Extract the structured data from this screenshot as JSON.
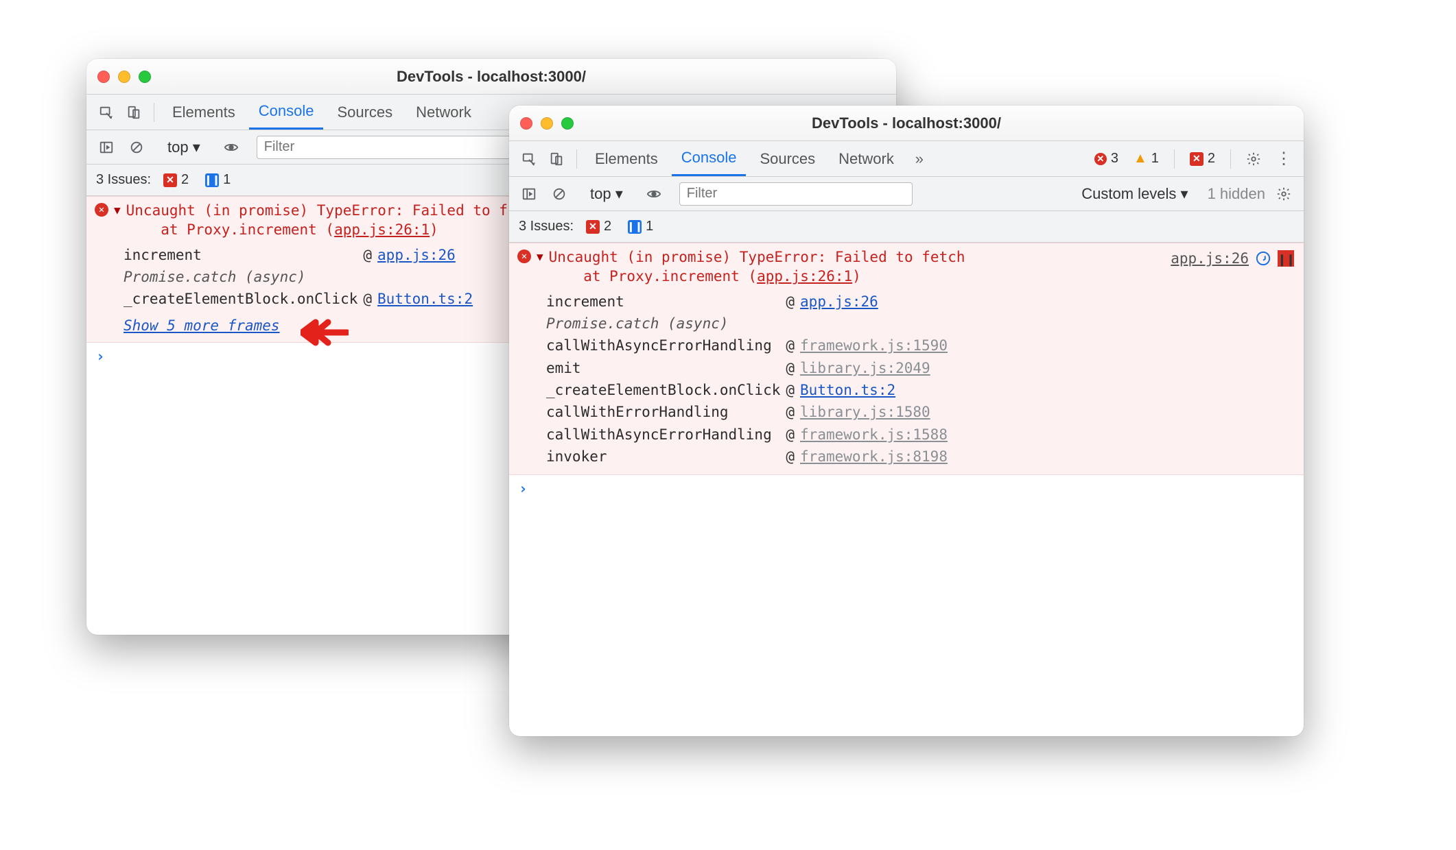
{
  "window1": {
    "title": "DevTools - localhost:3000/",
    "tabs": [
      "Elements",
      "Console",
      "Sources",
      "Network"
    ],
    "activeTab": "Console",
    "filterPlaceholder": "Filter",
    "context": "top",
    "issuesLabel": "3 Issues:",
    "issueErr": "2",
    "issueMsg": "1",
    "error": {
      "head1": "Uncaught (in promise) TypeError: Failed to f",
      "head2": "at Proxy.increment (",
      "headLoc": "app.js:26:1",
      "head2end": ")",
      "rows": [
        {
          "fn": "increment",
          "at": "@",
          "loc": "app.js:26",
          "muted": false
        },
        {
          "divider": "Promise.catch (async)"
        },
        {
          "fn": "_createElementBlock.onClick",
          "at": "@",
          "loc": "Button.ts:2",
          "muted": false
        }
      ],
      "showMore": "Show 5 more frames"
    }
  },
  "window2": {
    "title": "DevTools - localhost:3000/",
    "tabs": [
      "Elements",
      "Console",
      "Sources",
      "Network"
    ],
    "activeTab": "Console",
    "filterPlaceholder": "Filter",
    "context": "top",
    "levels": "Custom levels",
    "hidden": "1 hidden",
    "badges": {
      "err": "3",
      "warn": "1",
      "msg": "2"
    },
    "issuesLabel": "3 Issues:",
    "issueErr": "2",
    "issueMsg": "1",
    "error": {
      "head1": "Uncaught (in promise) TypeError: Failed to fetch",
      "head2": "at Proxy.increment (",
      "headLoc": "app.js:26:1",
      "head2end": ")",
      "srcRight": "app.js:26",
      "rows": [
        {
          "fn": "increment",
          "at": "@",
          "loc": "app.js:26",
          "muted": false
        },
        {
          "divider": "Promise.catch (async)"
        },
        {
          "fn": "callWithAsyncErrorHandling",
          "at": "@",
          "loc": "framework.js:1590",
          "muted": true
        },
        {
          "fn": "emit",
          "at": "@",
          "loc": "library.js:2049",
          "muted": true
        },
        {
          "fn": "_createElementBlock.onClick",
          "at": "@",
          "loc": "Button.ts:2",
          "muted": false
        },
        {
          "fn": "callWithErrorHandling",
          "at": "@",
          "loc": "library.js:1580",
          "muted": true
        },
        {
          "fn": "callWithAsyncErrorHandling",
          "at": "@",
          "loc": "framework.js:1588",
          "muted": true
        },
        {
          "fn": "invoker",
          "at": "@",
          "loc": "framework.js:8198",
          "muted": true
        }
      ]
    }
  }
}
